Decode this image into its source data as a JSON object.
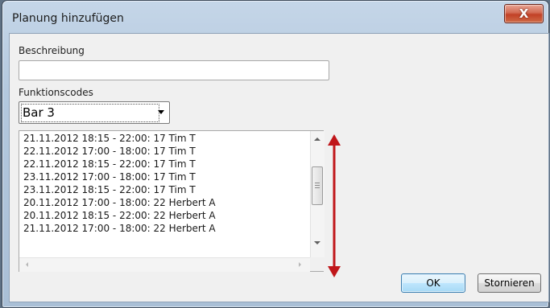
{
  "window": {
    "title": "Planung hinzufügen",
    "close_label": "X"
  },
  "form": {
    "description_label": "Beschreibung",
    "description_value": "",
    "function_codes_label": "Funktionscodes",
    "function_code_selected": "Bar 3"
  },
  "list": {
    "items": [
      "21.11.2012 18:15 - 22:00: 17 Tim T",
      "22.11.2012 17:00 - 18:00: 17 Tim T",
      "22.11.2012 18:15 - 22:00: 17 Tim T",
      "23.11.2012 17:00 - 18:00: 17 Tim T",
      "23.11.2012 18:15 - 22:00: 17 Tim T",
      "20.11.2012 17:00 - 18:00: 22 Herbert A",
      "20.11.2012 18:15 - 22:00: 22 Herbert A",
      "21.11.2012 17:00 - 18:00: 22 Herbert A"
    ]
  },
  "buttons": {
    "ok_label": "OK",
    "cancel_label": "Stornieren"
  },
  "annotation": {
    "color": "#c0161a",
    "icon": "double-headed-vertical-arrow"
  }
}
